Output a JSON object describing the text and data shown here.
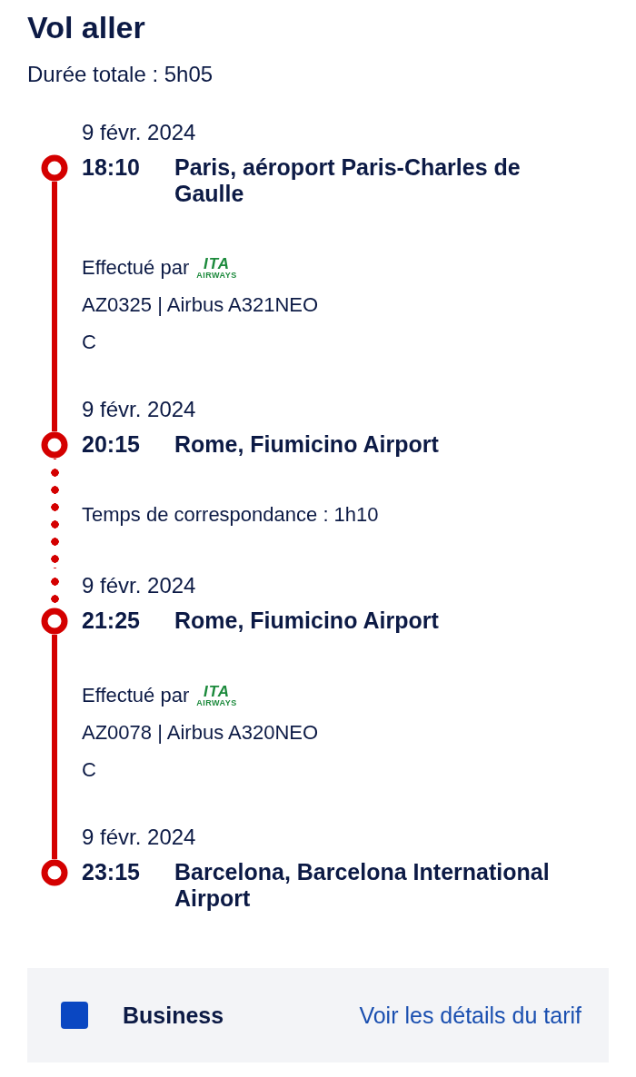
{
  "title": "Vol aller",
  "total_duration": "Durée totale : 5h05",
  "itinerary": [
    {
      "kind": "stop",
      "date": "9 févr. 2024",
      "time": "18:10",
      "place": "Paris, aéroport Paris-Charles de Gaulle"
    },
    {
      "kind": "flight",
      "operated_by": "Effectué par",
      "logo": {
        "mark": "ITA",
        "sub": "AIRWAYS"
      },
      "flight": "AZ0325 | Airbus A321NEO",
      "cabin": "C"
    },
    {
      "kind": "stop",
      "date": "9 févr. 2024",
      "time": "20:15",
      "place": "Rome, Fiumicino Airport"
    },
    {
      "kind": "connection",
      "text": "Temps de correspondance : 1h10"
    },
    {
      "kind": "stop",
      "date": "9 févr. 2024",
      "time": "21:25",
      "place": "Rome, Fiumicino Airport"
    },
    {
      "kind": "flight",
      "operated_by": "Effectué par",
      "logo": {
        "mark": "ITA",
        "sub": "AIRWAYS"
      },
      "flight": "AZ0078 | Airbus A320NEO",
      "cabin": "C"
    },
    {
      "kind": "stop",
      "date": "9 févr. 2024",
      "time": "23:15",
      "place": "Barcelona, Barcelona International Airport"
    }
  ],
  "fare": {
    "cabin": "Business",
    "link": "Voir les détails du tarif"
  }
}
